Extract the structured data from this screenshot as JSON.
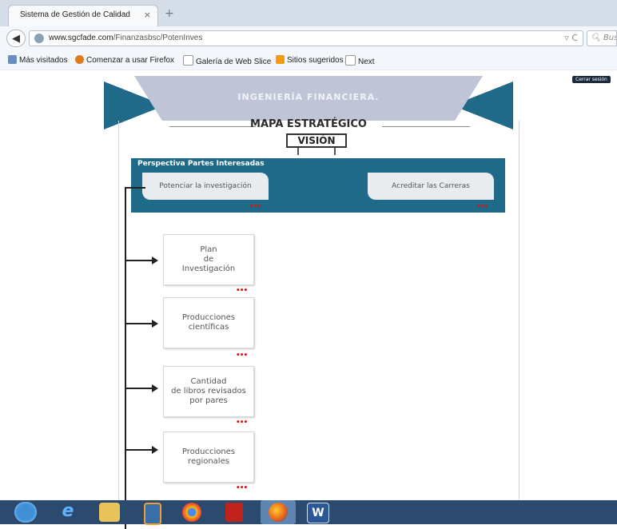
{
  "browser": {
    "tab_title": "Sistema de Gestión de Calidad",
    "tab_close": "×",
    "new_tab": "+",
    "url_host": "www.sgcfade.com",
    "url_path": "/Finanzasbsc/PotenInves",
    "search_placeholder": "Bus",
    "url_icons": "▿ C",
    "bookmarks": [
      {
        "label": "Más visitados",
        "color": "#6a8fbf"
      },
      {
        "label": "Comenzar a usar Firefox",
        "color": "#e07a1f"
      },
      {
        "label": "Galería de Web Slice",
        "color": "#ffffff"
      },
      {
        "label": "Sitios sugeridos",
        "color": "#f39c12"
      },
      {
        "label": "Next",
        "color": "#ffffff"
      }
    ]
  },
  "page": {
    "logout_label": "Cerrar sesión",
    "banner_title": "INGENIERÍA FINANCIERA.",
    "map_title": "MAPA ESTRATÉGICO",
    "vision_label": "VISIÓN",
    "panel_title": "Perspectiva Partes Interesadas",
    "objectives": [
      {
        "label": "Potenciar la investigación"
      },
      {
        "label": "Acreditar las Carreras"
      }
    ],
    "cards": [
      {
        "lines": [
          "Plan",
          "de",
          "Investigación"
        ]
      },
      {
        "lines": [
          "Producciones",
          "científicas"
        ]
      },
      {
        "lines": [
          "Cantidad",
          "de libros revisados",
          "por pares"
        ]
      },
      {
        "lines": [
          "Producciones",
          "regionales"
        ]
      }
    ],
    "dots": "•••"
  },
  "taskbar": {
    "items": [
      "start-orb",
      "internet-explorer",
      "file-explorer",
      "media-player",
      "chrome",
      "app-red",
      "firefox",
      "word"
    ]
  },
  "colors": {
    "panel": "#1f6a88",
    "banner": "#bfc4d6",
    "dots": "#d8151b",
    "taskbar": "#2b4a6e"
  }
}
